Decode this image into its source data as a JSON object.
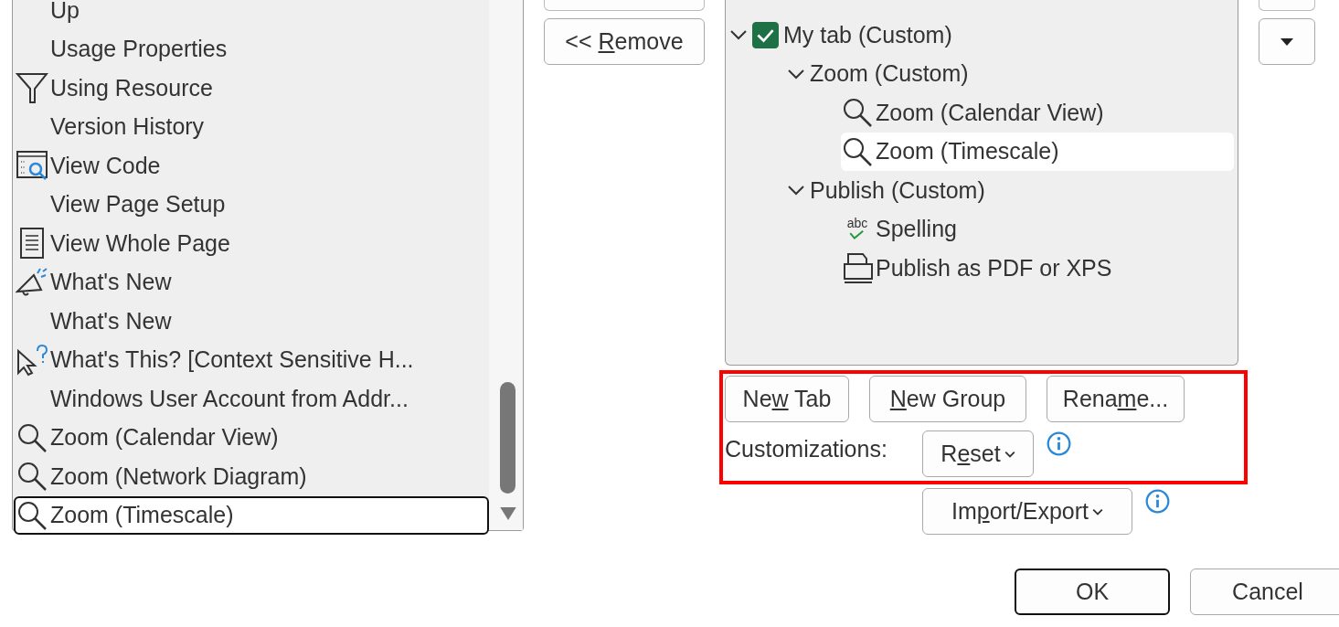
{
  "commands": [
    {
      "label": "Up",
      "selected": false
    },
    {
      "label": "Usage Properties",
      "selected": false
    },
    {
      "label": "Using Resource",
      "selected": false
    },
    {
      "label": "Version History",
      "selected": false
    },
    {
      "label": "View Code",
      "selected": false
    },
    {
      "label": "View Page Setup",
      "selected": false
    },
    {
      "label": "View Whole Page",
      "selected": false
    },
    {
      "label": "What's New",
      "selected": false
    },
    {
      "label": "What's New",
      "selected": false
    },
    {
      "label": "What's This? [Context Sensitive H...",
      "selected": false
    },
    {
      "label": "Windows User Account from Addr...",
      "selected": false
    },
    {
      "label": "Zoom (Calendar View)",
      "selected": false
    },
    {
      "label": "Zoom (Network Diagram)",
      "selected": false
    },
    {
      "label": "Zoom (Timescale)",
      "selected": true
    }
  ],
  "remove_button": {
    "before": "<< ",
    "key": "R",
    "after": "emove"
  },
  "tree": [
    {
      "label": "My tab (Custom)",
      "expanded": true,
      "checked": true,
      "selected": false,
      "children": [
        {
          "label": "Zoom (Custom)",
          "expanded": true,
          "selected": false,
          "children": [
            {
              "label": "Zoom (Calendar View)",
              "selected": false
            },
            {
              "label": "Zoom (Timescale)",
              "selected": true
            }
          ]
        },
        {
          "label": "Publish (Custom)",
          "expanded": true,
          "selected": false,
          "children": [
            {
              "label": "Spelling",
              "icon_text": "abc",
              "selected": false
            },
            {
              "label": "Publish as PDF or XPS",
              "selected": false
            }
          ]
        }
      ]
    }
  ],
  "tab_buttons": [
    {
      "before": "Ne",
      "key": "w",
      "after": " Tab"
    },
    {
      "key": "N",
      "after": "ew Group"
    },
    {
      "before": "Rena",
      "key": "m",
      "after": "e..."
    }
  ],
  "customizations_label": "Customizations:",
  "reset_button": {
    "before": "R",
    "key": "e",
    "after": "set",
    "dropdown": true
  },
  "import_export_button": {
    "before": "Im",
    "key": "p",
    "after": "ort/Export",
    "dropdown": true
  },
  "dialog_buttons": [
    {
      "before": "OK",
      "default": true
    },
    {
      "before": "Cancel",
      "default": false
    }
  ]
}
